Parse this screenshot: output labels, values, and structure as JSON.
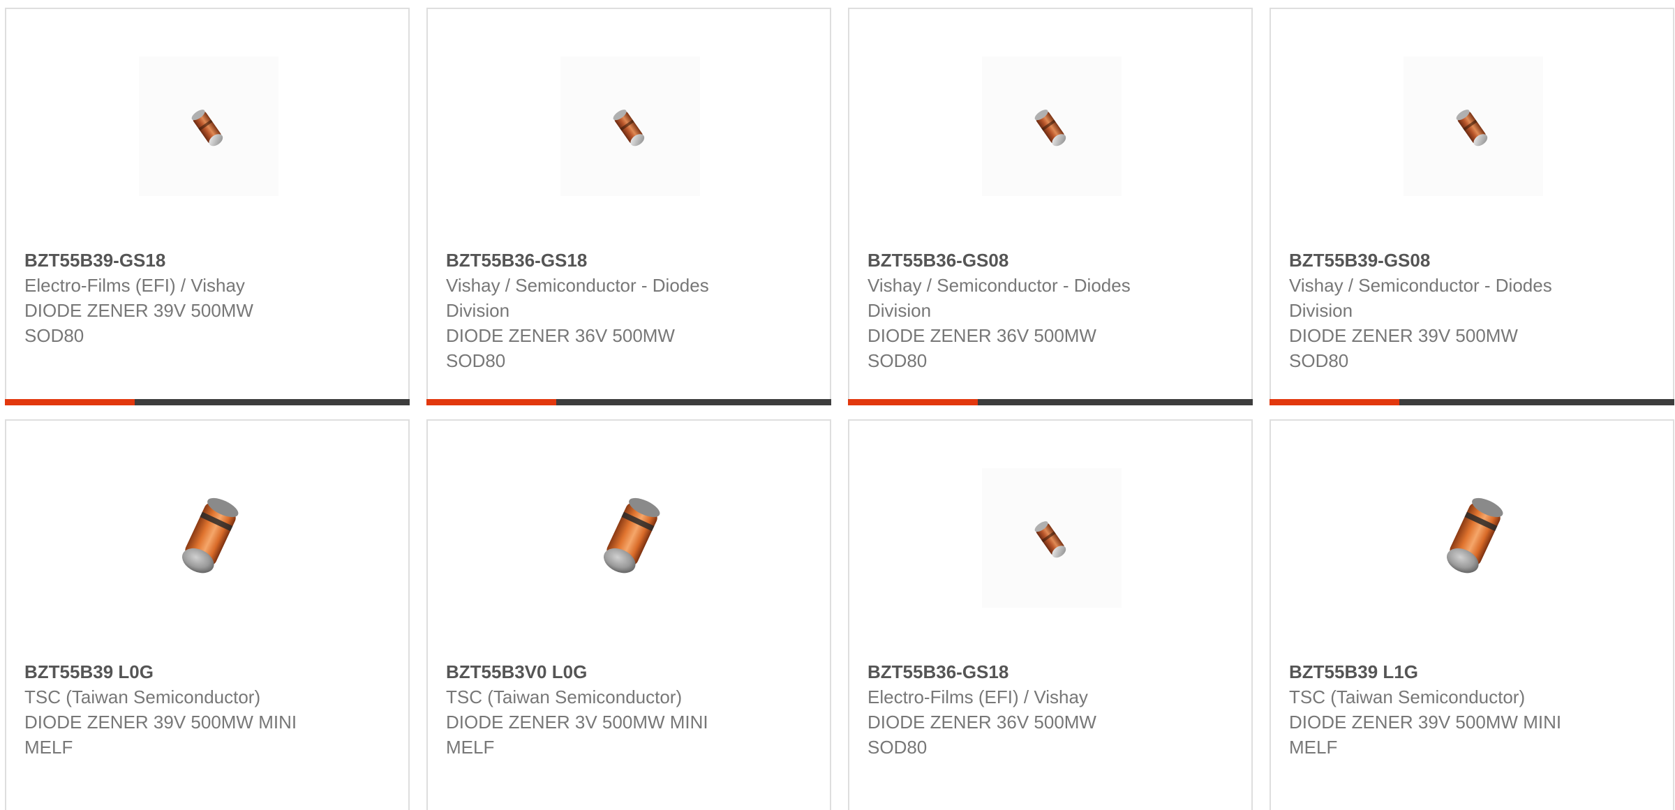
{
  "colors": {
    "card_border": "#dedede",
    "accent_bar": "#e2380e",
    "bar_track": "#3d3d3d",
    "part_text": "#555555",
    "detail_text": "#777777"
  },
  "products": [
    {
      "part_number": "BZT55B39-GS18",
      "manufacturer": "Electro-Films (EFI) / Vishay",
      "description": "DIODE ZENER 39V 500MW",
      "package": "SOD80",
      "image_icon": "sod80-diode-icon",
      "progress_fraction": 0.32
    },
    {
      "part_number": "BZT55B36-GS18",
      "manufacturer": "Vishay / Semiconductor - Diodes Division",
      "description": "DIODE ZENER 36V 500MW",
      "package": "SOD80",
      "image_icon": "sod80-diode-icon",
      "progress_fraction": 0.32
    },
    {
      "part_number": "BZT55B36-GS08",
      "manufacturer": "Vishay / Semiconductor - Diodes Division",
      "description": "DIODE ZENER 36V 500MW",
      "package": "SOD80",
      "image_icon": "sod80-diode-icon",
      "progress_fraction": 0.32
    },
    {
      "part_number": "BZT55B39-GS08",
      "manufacturer": "Vishay / Semiconductor - Diodes Division",
      "description": "DIODE ZENER 39V 500MW",
      "package": "SOD80",
      "image_icon": "sod80-diode-icon",
      "progress_fraction": 0.32
    },
    {
      "part_number": "BZT55B39 L0G",
      "manufacturer": "TSC (Taiwan Semiconductor)",
      "description": "DIODE ZENER 39V 500MW MINI MELF",
      "package": "",
      "image_icon": "minimelf-diode-icon"
    },
    {
      "part_number": "BZT55B3V0 L0G",
      "manufacturer": "TSC (Taiwan Semiconductor)",
      "description": "DIODE ZENER 3V 500MW MINI MELF",
      "package": "",
      "image_icon": "minimelf-diode-icon"
    },
    {
      "part_number": "BZT55B36-GS18",
      "manufacturer": "Electro-Films (EFI) / Vishay",
      "description": "DIODE ZENER 36V 500MW",
      "package": "SOD80",
      "image_icon": "sod80-diode-icon"
    },
    {
      "part_number": "BZT55B39 L1G",
      "manufacturer": "TSC (Taiwan Semiconductor)",
      "description": "DIODE ZENER 39V 500MW MINI MELF",
      "package": "",
      "image_icon": "minimelf-diode-icon"
    }
  ]
}
